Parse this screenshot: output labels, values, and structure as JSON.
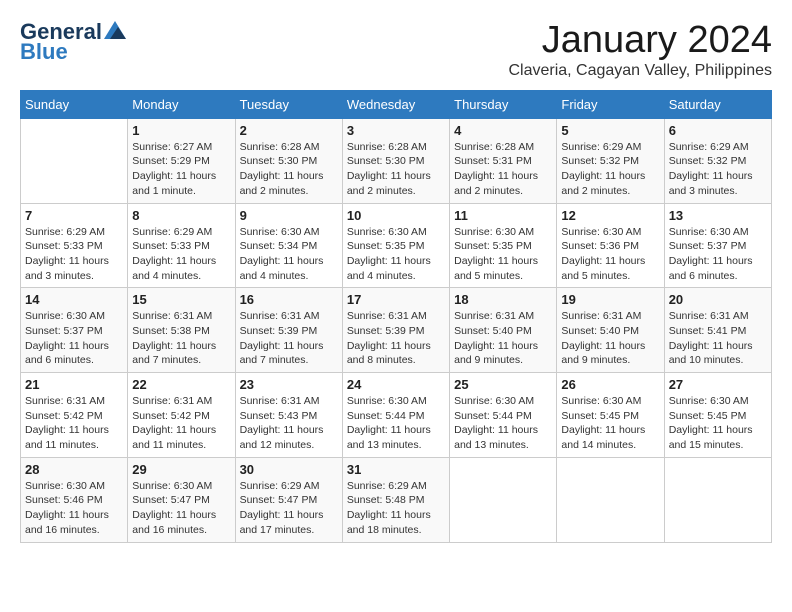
{
  "logo": {
    "line1": "General",
    "line2": "Blue"
  },
  "title": "January 2024",
  "location": "Claveria, Cagayan Valley, Philippines",
  "headers": [
    "Sunday",
    "Monday",
    "Tuesday",
    "Wednesday",
    "Thursday",
    "Friday",
    "Saturday"
  ],
  "weeks": [
    [
      {
        "day": "",
        "info": ""
      },
      {
        "day": "1",
        "info": "Sunrise: 6:27 AM\nSunset: 5:29 PM\nDaylight: 11 hours and 1 minute."
      },
      {
        "day": "2",
        "info": "Sunrise: 6:28 AM\nSunset: 5:30 PM\nDaylight: 11 hours and 2 minutes."
      },
      {
        "day": "3",
        "info": "Sunrise: 6:28 AM\nSunset: 5:30 PM\nDaylight: 11 hours and 2 minutes."
      },
      {
        "day": "4",
        "info": "Sunrise: 6:28 AM\nSunset: 5:31 PM\nDaylight: 11 hours and 2 minutes."
      },
      {
        "day": "5",
        "info": "Sunrise: 6:29 AM\nSunset: 5:32 PM\nDaylight: 11 hours and 2 minutes."
      },
      {
        "day": "6",
        "info": "Sunrise: 6:29 AM\nSunset: 5:32 PM\nDaylight: 11 hours and 3 minutes."
      }
    ],
    [
      {
        "day": "7",
        "info": "Sunrise: 6:29 AM\nSunset: 5:33 PM\nDaylight: 11 hours and 3 minutes."
      },
      {
        "day": "8",
        "info": "Sunrise: 6:29 AM\nSunset: 5:33 PM\nDaylight: 11 hours and 4 minutes."
      },
      {
        "day": "9",
        "info": "Sunrise: 6:30 AM\nSunset: 5:34 PM\nDaylight: 11 hours and 4 minutes."
      },
      {
        "day": "10",
        "info": "Sunrise: 6:30 AM\nSunset: 5:35 PM\nDaylight: 11 hours and 4 minutes."
      },
      {
        "day": "11",
        "info": "Sunrise: 6:30 AM\nSunset: 5:35 PM\nDaylight: 11 hours and 5 minutes."
      },
      {
        "day": "12",
        "info": "Sunrise: 6:30 AM\nSunset: 5:36 PM\nDaylight: 11 hours and 5 minutes."
      },
      {
        "day": "13",
        "info": "Sunrise: 6:30 AM\nSunset: 5:37 PM\nDaylight: 11 hours and 6 minutes."
      }
    ],
    [
      {
        "day": "14",
        "info": "Sunrise: 6:30 AM\nSunset: 5:37 PM\nDaylight: 11 hours and 6 minutes."
      },
      {
        "day": "15",
        "info": "Sunrise: 6:31 AM\nSunset: 5:38 PM\nDaylight: 11 hours and 7 minutes."
      },
      {
        "day": "16",
        "info": "Sunrise: 6:31 AM\nSunset: 5:39 PM\nDaylight: 11 hours and 7 minutes."
      },
      {
        "day": "17",
        "info": "Sunrise: 6:31 AM\nSunset: 5:39 PM\nDaylight: 11 hours and 8 minutes."
      },
      {
        "day": "18",
        "info": "Sunrise: 6:31 AM\nSunset: 5:40 PM\nDaylight: 11 hours and 9 minutes."
      },
      {
        "day": "19",
        "info": "Sunrise: 6:31 AM\nSunset: 5:40 PM\nDaylight: 11 hours and 9 minutes."
      },
      {
        "day": "20",
        "info": "Sunrise: 6:31 AM\nSunset: 5:41 PM\nDaylight: 11 hours and 10 minutes."
      }
    ],
    [
      {
        "day": "21",
        "info": "Sunrise: 6:31 AM\nSunset: 5:42 PM\nDaylight: 11 hours and 11 minutes."
      },
      {
        "day": "22",
        "info": "Sunrise: 6:31 AM\nSunset: 5:42 PM\nDaylight: 11 hours and 11 minutes."
      },
      {
        "day": "23",
        "info": "Sunrise: 6:31 AM\nSunset: 5:43 PM\nDaylight: 11 hours and 12 minutes."
      },
      {
        "day": "24",
        "info": "Sunrise: 6:30 AM\nSunset: 5:44 PM\nDaylight: 11 hours and 13 minutes."
      },
      {
        "day": "25",
        "info": "Sunrise: 6:30 AM\nSunset: 5:44 PM\nDaylight: 11 hours and 13 minutes."
      },
      {
        "day": "26",
        "info": "Sunrise: 6:30 AM\nSunset: 5:45 PM\nDaylight: 11 hours and 14 minutes."
      },
      {
        "day": "27",
        "info": "Sunrise: 6:30 AM\nSunset: 5:45 PM\nDaylight: 11 hours and 15 minutes."
      }
    ],
    [
      {
        "day": "28",
        "info": "Sunrise: 6:30 AM\nSunset: 5:46 PM\nDaylight: 11 hours and 16 minutes."
      },
      {
        "day": "29",
        "info": "Sunrise: 6:30 AM\nSunset: 5:47 PM\nDaylight: 11 hours and 16 minutes."
      },
      {
        "day": "30",
        "info": "Sunrise: 6:29 AM\nSunset: 5:47 PM\nDaylight: 11 hours and 17 minutes."
      },
      {
        "day": "31",
        "info": "Sunrise: 6:29 AM\nSunset: 5:48 PM\nDaylight: 11 hours and 18 minutes."
      },
      {
        "day": "",
        "info": ""
      },
      {
        "day": "",
        "info": ""
      },
      {
        "day": "",
        "info": ""
      }
    ]
  ]
}
